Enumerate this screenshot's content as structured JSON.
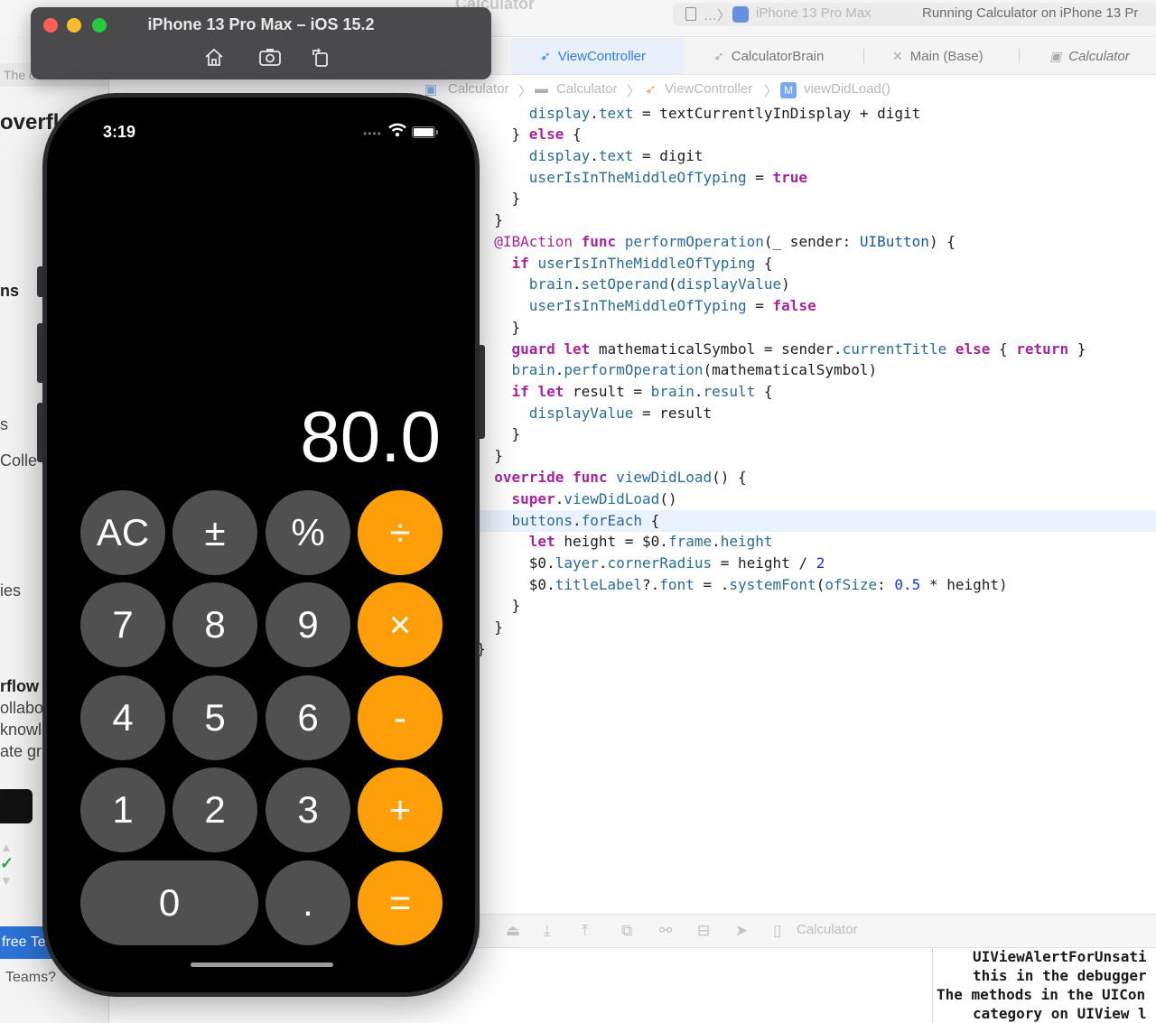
{
  "xcode": {
    "toolbar_title": "Calculator",
    "scheme": {
      "crumb": "…〉",
      "device": "iPhone 13 Pro Max",
      "status": "Running Calculator on iPhone 13 Pr"
    },
    "tabs": [
      {
        "label": "ViewController"
      },
      {
        "label": "CalculatorBrain"
      },
      {
        "label": "Main (Base)"
      },
      {
        "label": "Calculator"
      }
    ],
    "jumpbar": [
      "Calculator",
      "Calculator",
      "ViewController",
      "viewDidLoad()"
    ],
    "jumpbar_badge": "M",
    "debug_target": "Calculator",
    "console_lines": [
      "UIViewAlertForUnsati",
      "this in the debugger",
      "The methods in the UICon",
      "category on UIView l"
    ]
  },
  "browser": {
    "address_text": "The c",
    "fragments": [
      "overfl",
      "ns",
      "s",
      "Colle",
      "ies",
      "rflow",
      "ollabo",
      "knowle",
      "ate gr"
    ],
    "bottom_button": "free Te",
    "teams_text": "Teams?"
  },
  "simulator": {
    "title": "iPhone 13 Pro Max – iOS 15.2",
    "tools": [
      "home-icon",
      "screenshot-icon",
      "rotate-icon"
    ]
  },
  "phone": {
    "time": "3:19",
    "display": "80.0",
    "keys": {
      "ac": "AC",
      "plusminus": "±",
      "percent": "%",
      "divide": "÷",
      "seven": "7",
      "eight": "8",
      "nine": "9",
      "multiply": "×",
      "four": "4",
      "five": "5",
      "six": "6",
      "minus": "-",
      "one": "1",
      "two": "2",
      "three": "3",
      "plus": "+",
      "zero": "0",
      "decimal": ".",
      "equals": "="
    }
  },
  "colors": {
    "operator_key": "#fe9f09",
    "digit_key": "#505050",
    "screen": "#000000",
    "active_tab": "#2d7cf6",
    "keyword": "#a3279b"
  }
}
